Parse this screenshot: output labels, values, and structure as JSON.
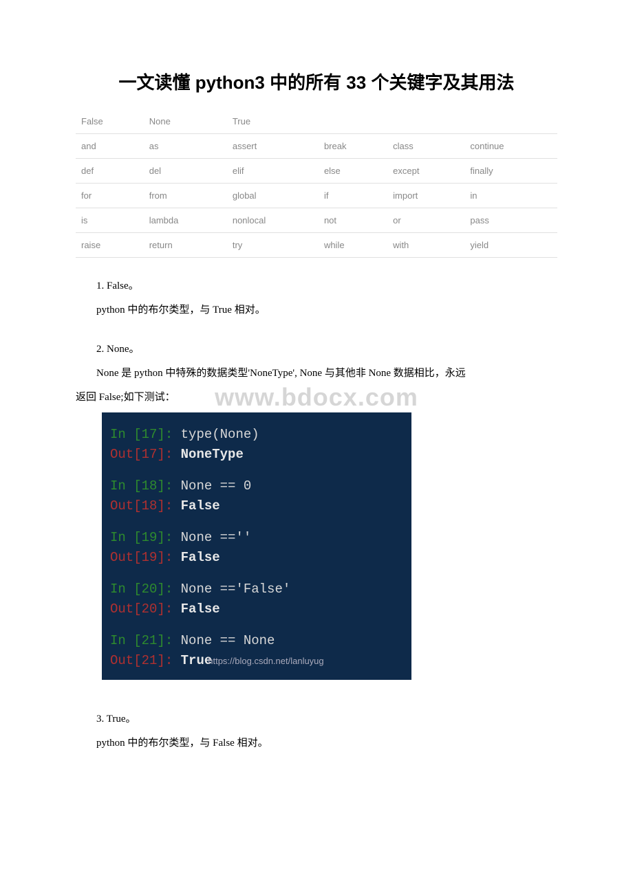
{
  "title": "一文读懂 python3 中的所有 33 个关键字及其用法",
  "keyword_table": {
    "rows": [
      [
        "False",
        "None",
        "True",
        "",
        "",
        ""
      ],
      [
        "and",
        "as",
        "assert",
        "break",
        "class",
        "continue"
      ],
      [
        "def",
        "del",
        "elif",
        "else",
        "except",
        "finally"
      ],
      [
        "for",
        "from",
        "global",
        "if",
        "import",
        "in"
      ],
      [
        "is",
        "lambda",
        "nonlocal",
        "not",
        "or",
        "pass"
      ],
      [
        "raise",
        "return",
        "try",
        "while",
        "with",
        "yield"
      ]
    ]
  },
  "sections": {
    "s1": {
      "heading": "1. False。",
      "body": "python 中的布尔类型，与 True 相对。"
    },
    "s2": {
      "heading": "2. None。",
      "body1": "None 是 python 中特殊的数据类型'NoneType', None 与其他非 None 数据相比，永远",
      "body2": "返回 False;如下测试："
    },
    "s3": {
      "heading": "3. True。",
      "body": "python 中的布尔类型，与 False 相对。"
    }
  },
  "watermark": "www.bdocx.com",
  "terminal": {
    "blocks": [
      {
        "in_num": "17",
        "in_code": "type(None)",
        "out_num": "17",
        "out_val": "NoneType"
      },
      {
        "in_num": "18",
        "in_code": "None == 0",
        "out_num": "18",
        "out_val": "False"
      },
      {
        "in_num": "19",
        "in_code": "None ==''",
        "out_num": "19",
        "out_val": "False"
      },
      {
        "in_num": "20",
        "in_code": "None =='False'",
        "out_num": "20",
        "out_val": "False"
      },
      {
        "in_num": "21",
        "in_code": "None == None",
        "out_num": "21",
        "out_val": "True",
        "blog": "https://blog.csdn.net/lanluyug"
      }
    ]
  }
}
